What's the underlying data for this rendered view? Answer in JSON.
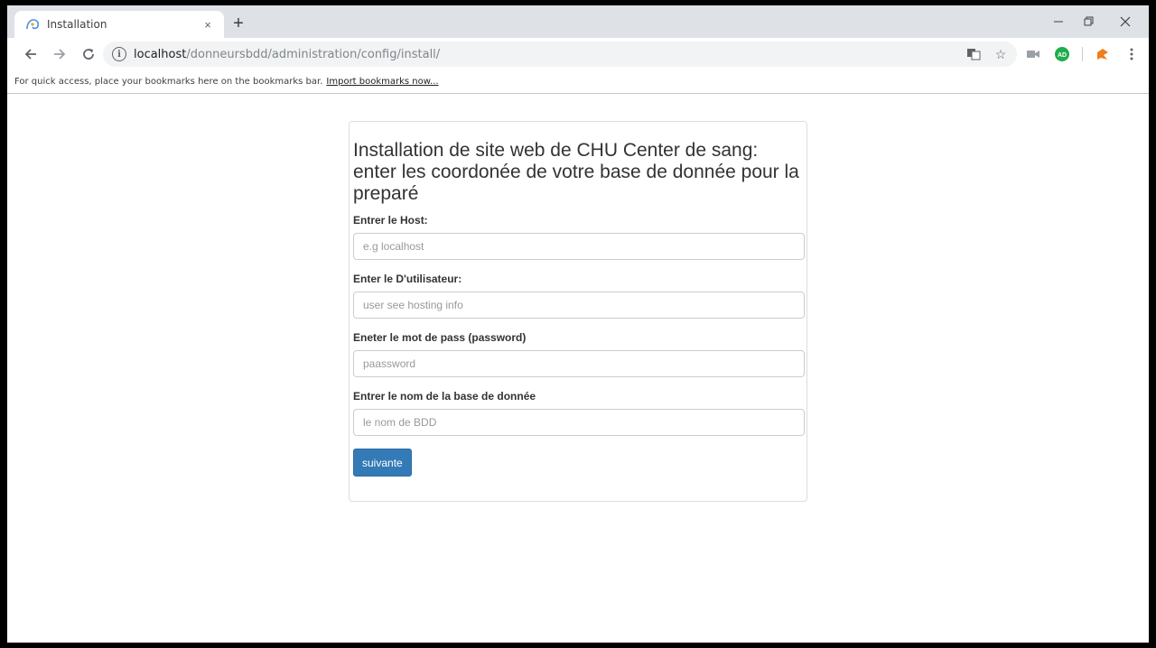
{
  "browser": {
    "tab_title": "Installation",
    "tab_close": "×",
    "new_tab": "+",
    "url_host": "localhost",
    "url_path": "/donneursbdd/administration/config/install/",
    "ext_badge": "AD",
    "bookmarks_text": "For quick access, place your bookmarks here on the bookmarks bar.",
    "bookmarks_link": "Import bookmarks now...",
    "icons": [
      "back-icon",
      "forward-icon",
      "reload-icon",
      "info-icon",
      "translate-icon",
      "star-icon",
      "camera-icon",
      "adblock-icon",
      "puzzle-icon",
      "menu-icon"
    ]
  },
  "form": {
    "title": "Installation de site web de CHU Center de sang: enter les coordonée de votre base de donnée pour la preparé",
    "fields": [
      {
        "label": "Entrer le Host:",
        "placeholder": "e.g localhost",
        "value": ""
      },
      {
        "label": "Enter le D'utilisateur:",
        "placeholder": "user see hosting info",
        "value": ""
      },
      {
        "label": "Eneter le mot de pass (password)",
        "placeholder": "paassword",
        "value": ""
      },
      {
        "label": "Entrer le nom de la base de donnée",
        "placeholder": "le nom de BDD",
        "value": ""
      }
    ],
    "submit_label": "suivante"
  },
  "colors": {
    "primary_button": "#337ab7",
    "tabstrip": "#dee1e6",
    "omnibox": "#f1f3f4"
  }
}
